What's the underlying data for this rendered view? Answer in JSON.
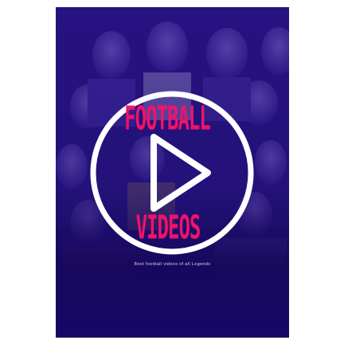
{
  "poster": {
    "title_line1": "FOOTBALL",
    "title_line2": "VIDEOS",
    "tagline": "Best football videos of all Legends",
    "icon": "play-circle-icon",
    "colors": {
      "background": "#1c0d6e",
      "title": "#f1126a",
      "icon": "#ffffff",
      "tagline": "#d9d6f0"
    }
  }
}
